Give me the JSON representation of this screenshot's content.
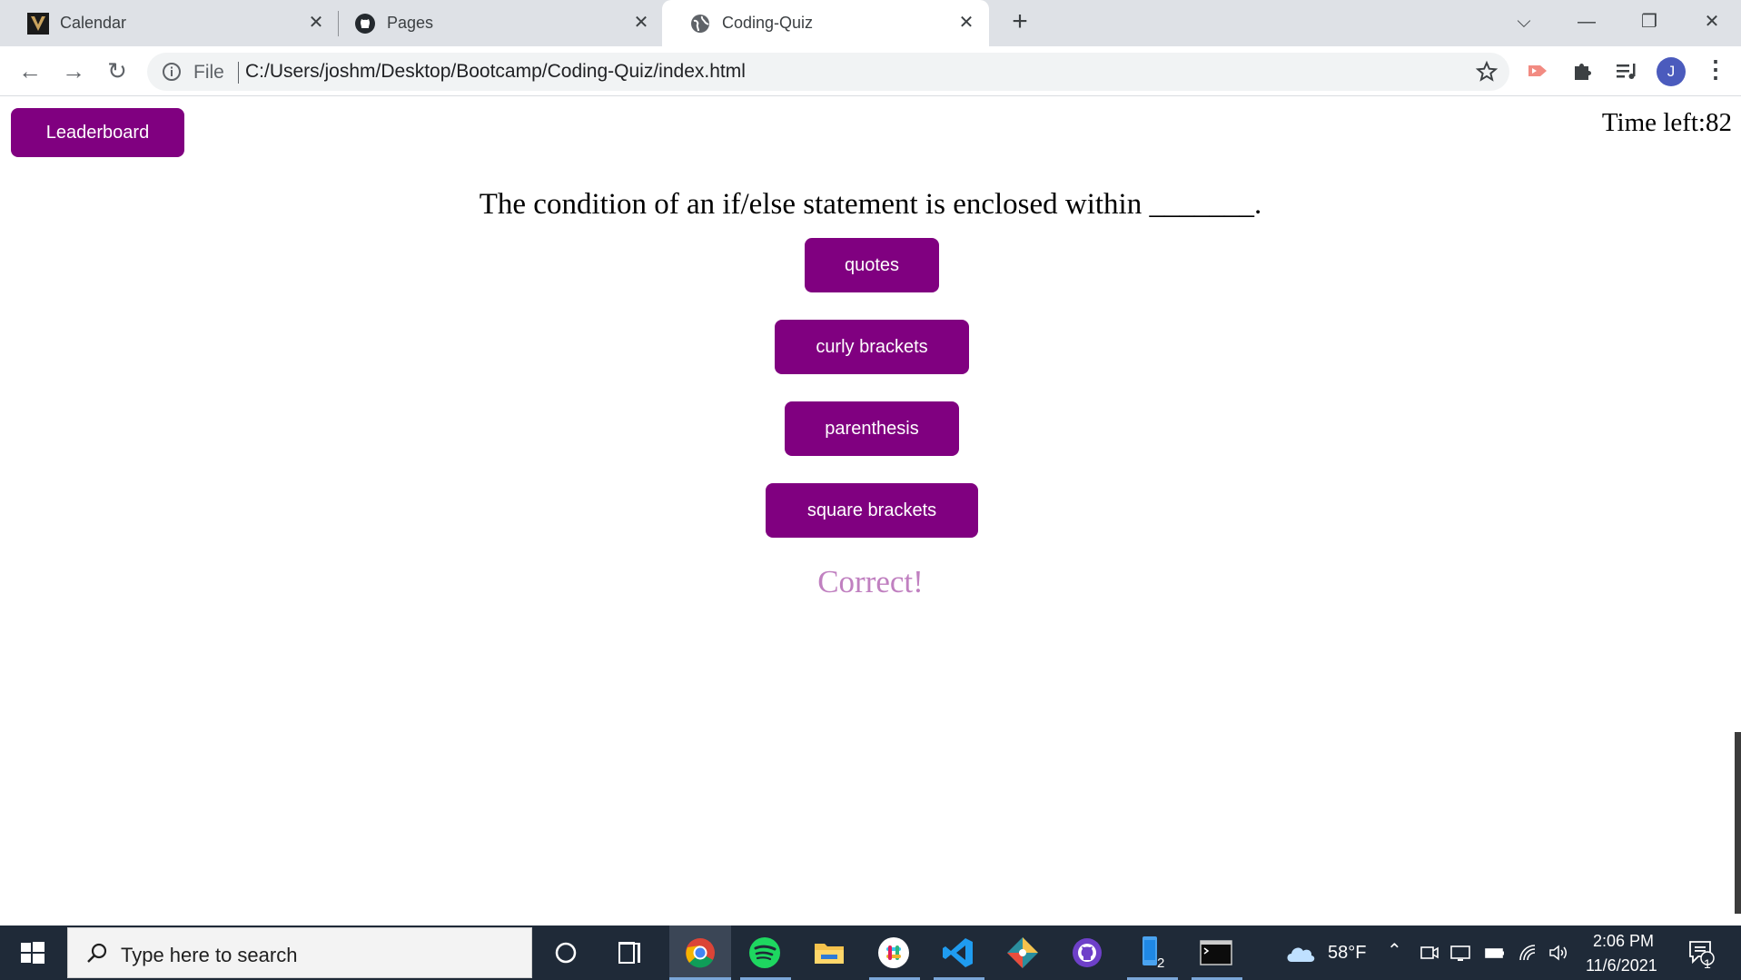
{
  "browser": {
    "tabs": [
      {
        "title": "Calendar",
        "icon": "vanderbilt-logo-icon",
        "active": false
      },
      {
        "title": "Pages",
        "icon": "github-icon",
        "active": false
      },
      {
        "title": "Coding-Quiz",
        "icon": "globe-icon",
        "active": true
      }
    ],
    "address": {
      "scheme": "File",
      "url": "C:/Users/joshm/Desktop/Bootcamp/Coding-Quiz/index.html"
    },
    "profile_initial": "J"
  },
  "quiz": {
    "leaderboard_label": "Leaderboard",
    "timer_text": "Time left:82",
    "question": "The condition of an if/else statement is enclosed within _______.",
    "answers": [
      "quotes",
      "curly brackets",
      "parenthesis",
      "square brackets"
    ],
    "feedback": "Correct!"
  },
  "taskbar": {
    "search_placeholder": "Type here to search",
    "weather": "58°F",
    "time": "2:06 PM",
    "date": "11/6/2021",
    "file_explorer_badge": "2",
    "notification_count": "1"
  },
  "colors": {
    "accent": "#800080",
    "feedback": "#c080c0"
  }
}
